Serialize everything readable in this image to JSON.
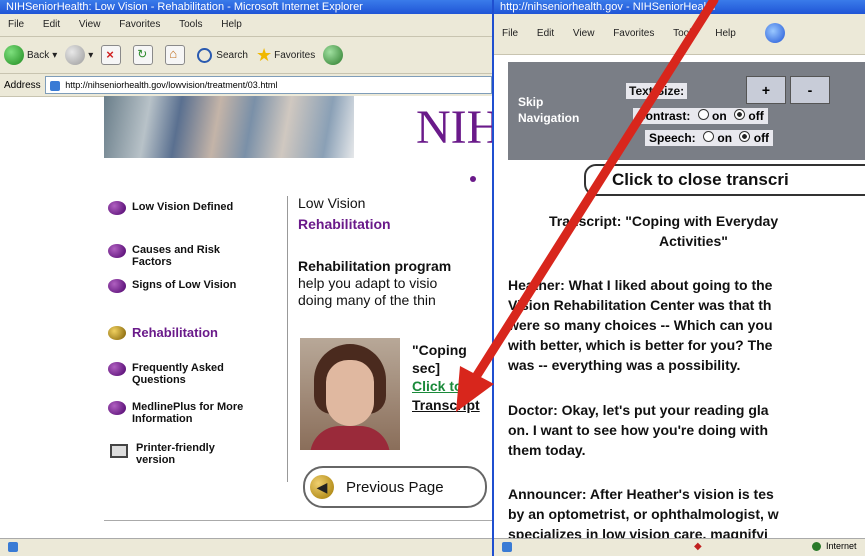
{
  "left_window": {
    "title": "NIHSeniorHealth: Low Vision - Rehabilitation - Microsoft Internet Explorer",
    "menu": [
      "File",
      "Edit",
      "View",
      "Favorites",
      "Tools",
      "Help"
    ],
    "toolbar": {
      "back": "Back",
      "search": "Search",
      "favorites": "Favorites"
    },
    "address_label": "Address",
    "address_value": "http://nihseniorhealth.gov/lowvision/treatment/03.html",
    "banner_text": "NIH",
    "nav_items": [
      {
        "label": "Low Vision Defined"
      },
      {
        "label": "Causes and Risk Factors"
      },
      {
        "label": "Signs of Low Vision"
      },
      {
        "label": "Rehabilitation"
      },
      {
        "label": "Frequently Asked Questions"
      },
      {
        "label": "MedlinePlus for More Information"
      },
      {
        "label": "Printer-friendly version"
      }
    ],
    "content": {
      "heading1": "Low Vision",
      "heading2": "Rehabilitation",
      "para_line1": "Rehabilitation program",
      "para_line2": "help you adapt to visio",
      "para_line3": "doing many of the thin",
      "video_title_line1": "\"Coping",
      "video_title_line2": "sec]",
      "video_link": "Click to w",
      "transcript_link": "Transcript",
      "previous_page": "Previous Page"
    }
  },
  "right_window": {
    "title": "http://nihseniorhealth.gov - NIHSeniorHealth",
    "menu": [
      "File",
      "Edit",
      "View",
      "Favorites",
      "Tools",
      "Help"
    ],
    "skip_nav": "Skip Navigation",
    "text_size_label": "Text Size:",
    "text_size_plus": "+",
    "text_size_minus": "-",
    "contrast_label": "Contrast:",
    "speech_label": "Speech:",
    "opt_on": "on",
    "opt_off": "off",
    "close_button": "Click to close transcri",
    "transcript_title_line1": "Transcript: \"Coping with Everyday",
    "transcript_title_line2": "Activities\"",
    "para1_lines": [
      "Heather: What I liked about going to the",
      "Vision Rehabilitation Center was that th",
      "were so many choices -- Which can you",
      "with better, which is better for you? The",
      "was -- everything was a possibility."
    ],
    "para2_lines": [
      "Doctor: Okay, let's put your reading gla",
      "on. I want to see how you're doing with",
      "them today."
    ],
    "para3_lines": [
      "Announcer: After Heather's vision is tes",
      "by an optometrist, or ophthalmologist, w",
      "specializes in low vision care, magnifyi"
    ],
    "status_zone": "Internet"
  },
  "colors": {
    "arrow": "#d8261c",
    "nav_purple": "#6a1a8a",
    "link_green": "#1a8a3a",
    "ie_blue": "#1f55d6"
  }
}
